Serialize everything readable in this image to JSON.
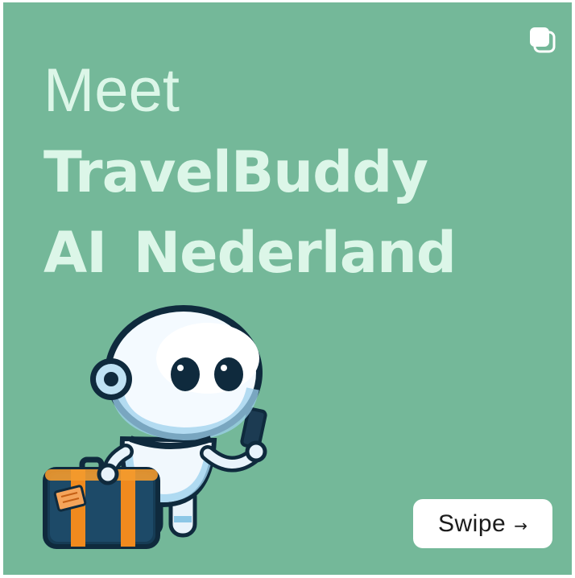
{
  "post": {
    "headline_line1": "Meet",
    "headline_line2": "TravelBuddy",
    "headline_line3": "AI  Nederland",
    "swipe_label": "Swipe",
    "swipe_arrow": "→",
    "multi_image_icon": "multiple-images-icon",
    "illustration": "robot-with-suitcase-and-phone"
  },
  "colors": {
    "background": "#74b899",
    "headline_text": "#dcf6e8",
    "button_bg": "#ffffff",
    "suitcase_orange": "#f08a1e",
    "robot_outline": "#0f2a3d"
  }
}
